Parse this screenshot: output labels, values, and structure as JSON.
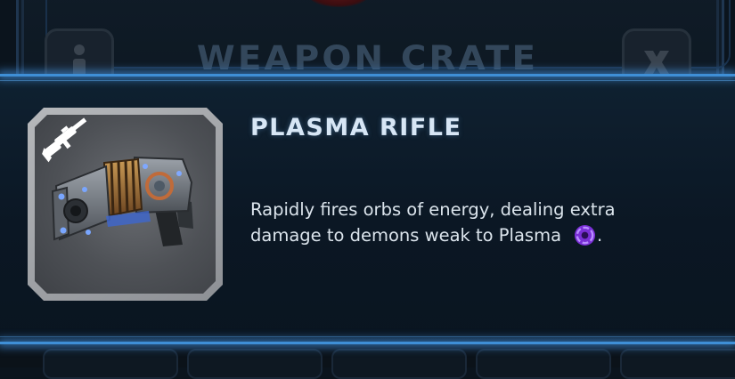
{
  "background": {
    "screen_title": "WEAPON CRATE",
    "info_icon": "info-icon",
    "close_icon": "close-icon"
  },
  "popup": {
    "weapon_name": "PLASMA RIFLE",
    "description_part1": "Rapidly fires orbs of energy, dealing extra damage to demons weak to Plasma",
    "description_end": ".",
    "damage_type_icon": "plasma-icon",
    "weapon_type_icon": "rifle-icon",
    "weapon_image": "plasma-rifle-image"
  },
  "colors": {
    "accent_glow": "#3f8fd6",
    "panel_bg": "#0b1724",
    "card_frame": "#b6b8bb",
    "plasma_purple": "#8a3fe0",
    "name_text": "#d7e6f5"
  }
}
